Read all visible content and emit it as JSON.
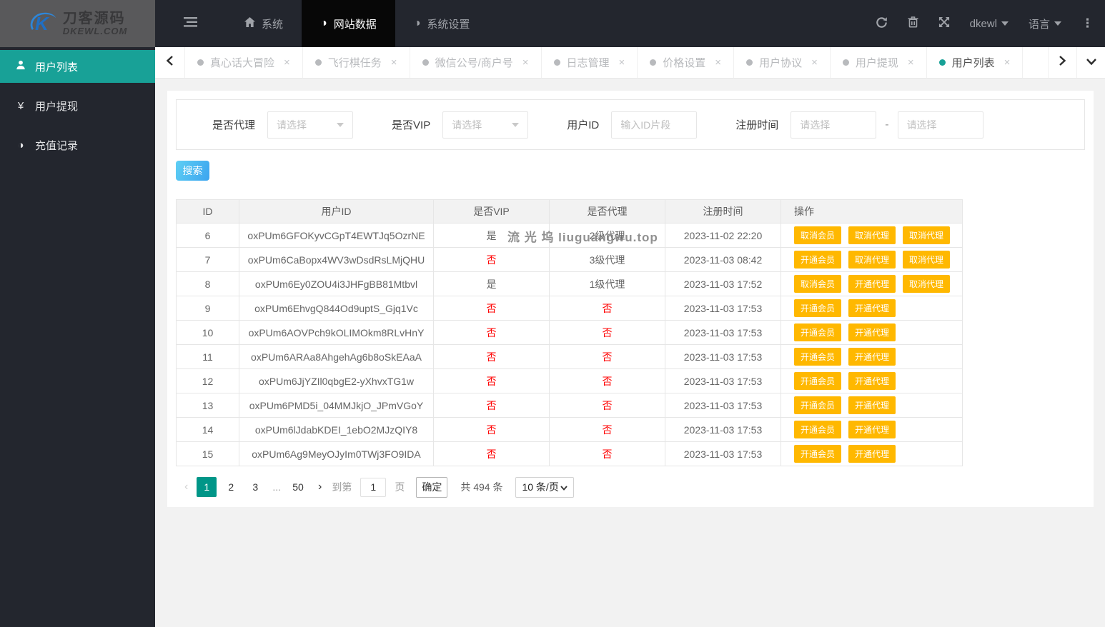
{
  "header": {
    "logo": {
      "brand": "刀客源码",
      "domain": "DKEWL.COM"
    },
    "nav": [
      {
        "label": "系统",
        "active": false
      },
      {
        "label": "网站数据",
        "active": true
      },
      {
        "label": "系统设置",
        "active": false
      }
    ],
    "user_menu": "dkewl",
    "language_menu": "语言"
  },
  "sidebar": {
    "items": [
      {
        "label": "用户列表",
        "active": true
      },
      {
        "label": "用户提现",
        "active": false
      },
      {
        "label": "充值记录",
        "active": false
      }
    ]
  },
  "tabs": {
    "items": [
      {
        "label": "真心话大冒险",
        "active": false
      },
      {
        "label": "飞行棋任务",
        "active": false
      },
      {
        "label": "微信公号/商户号",
        "active": false
      },
      {
        "label": "日志管理",
        "active": false
      },
      {
        "label": "价格设置",
        "active": false
      },
      {
        "label": "用户协议",
        "active": false
      },
      {
        "label": "用户提现",
        "active": false
      },
      {
        "label": "用户列表",
        "active": true
      }
    ]
  },
  "filters": {
    "agent": {
      "label": "是否代理",
      "placeholder": "请选择"
    },
    "vip": {
      "label": "是否VIP",
      "placeholder": "请选择"
    },
    "user_id": {
      "label": "用户ID",
      "placeholder": "输入ID片段"
    },
    "reg_time": {
      "label": "注册时间",
      "from_placeholder": "请选择",
      "to_placeholder": "请选择",
      "separator": "-"
    }
  },
  "search_button_label": "搜索",
  "table": {
    "columns": [
      "ID",
      "用户ID",
      "是否VIP",
      "是否代理",
      "注册时间",
      "操作"
    ],
    "rows": [
      {
        "id": "6",
        "user_id": "oxPUm6GFOKyvCGpT4EWTJq5OzrNE",
        "vip": "是",
        "agent": "2级代理",
        "reg_time": "2023-11-02 22:20",
        "actions": [
          "取消会员",
          "取消代理",
          "取消代理"
        ]
      },
      {
        "id": "7",
        "user_id": "oxPUm6CaBopx4WV3wDsdRsLMjQHU",
        "vip": "否",
        "agent": "3级代理",
        "reg_time": "2023-11-03 08:42",
        "actions": [
          "开通会员",
          "取消代理",
          "取消代理"
        ]
      },
      {
        "id": "8",
        "user_id": "oxPUm6Ey0ZOU4i3JHFgBB81Mtbvl",
        "vip": "是",
        "agent": "1级代理",
        "reg_time": "2023-11-03 17:52",
        "actions": [
          "取消会员",
          "开通代理",
          "取消代理"
        ]
      },
      {
        "id": "9",
        "user_id": "oxPUm6EhvgQ844Od9uptS_Gjq1Vc",
        "vip": "否",
        "agent": "否",
        "reg_time": "2023-11-03 17:53",
        "actions": [
          "开通会员",
          "开通代理"
        ]
      },
      {
        "id": "10",
        "user_id": "oxPUm6AOVPch9kOLIMOkm8RLvHnY",
        "vip": "否",
        "agent": "否",
        "reg_time": "2023-11-03 17:53",
        "actions": [
          "开通会员",
          "开通代理"
        ]
      },
      {
        "id": "11",
        "user_id": "oxPUm6ARAa8AhgehAg6b8oSkEAaA",
        "vip": "否",
        "agent": "否",
        "reg_time": "2023-11-03 17:53",
        "actions": [
          "开通会员",
          "开通代理"
        ]
      },
      {
        "id": "12",
        "user_id": "oxPUm6JjYZIl0qbgE2-yXhvxTG1w",
        "vip": "否",
        "agent": "否",
        "reg_time": "2023-11-03 17:53",
        "actions": [
          "开通会员",
          "开通代理"
        ]
      },
      {
        "id": "13",
        "user_id": "oxPUm6PMD5i_04MMJkjO_JPmVGoY",
        "vip": "否",
        "agent": "否",
        "reg_time": "2023-11-03 17:53",
        "actions": [
          "开通会员",
          "开通代理"
        ]
      },
      {
        "id": "14",
        "user_id": "oxPUm6lJdabKDEI_1ebO2MJzQIY8",
        "vip": "否",
        "agent": "否",
        "reg_time": "2023-11-03 17:53",
        "actions": [
          "开通会员",
          "开通代理"
        ]
      },
      {
        "id": "15",
        "user_id": "oxPUm6Ag9MeyOJyIm0TWj3FO9IDA",
        "vip": "否",
        "agent": "否",
        "reg_time": "2023-11-03 17:53",
        "actions": [
          "开通会员",
          "开通代理"
        ]
      }
    ]
  },
  "watermark": "流 光 坞 liuguangwu.top",
  "pagination": {
    "prev": "‹",
    "next": "›",
    "pages": [
      "1",
      "2",
      "3",
      "...",
      "50"
    ],
    "active_page": "1",
    "goto_label": "到第",
    "goto_value": "1",
    "goto_unit": "页",
    "confirm_label": "确定",
    "total_label": "共 494 条",
    "page_size_label": "10 条/页"
  },
  "colors": {
    "accent_teal": "#18A197",
    "pagination_active": "#009688",
    "action_button": "#FFB800",
    "negative_red": "#FF0000",
    "search_button": "#4CBCF2",
    "header_dark": "#23262E"
  }
}
